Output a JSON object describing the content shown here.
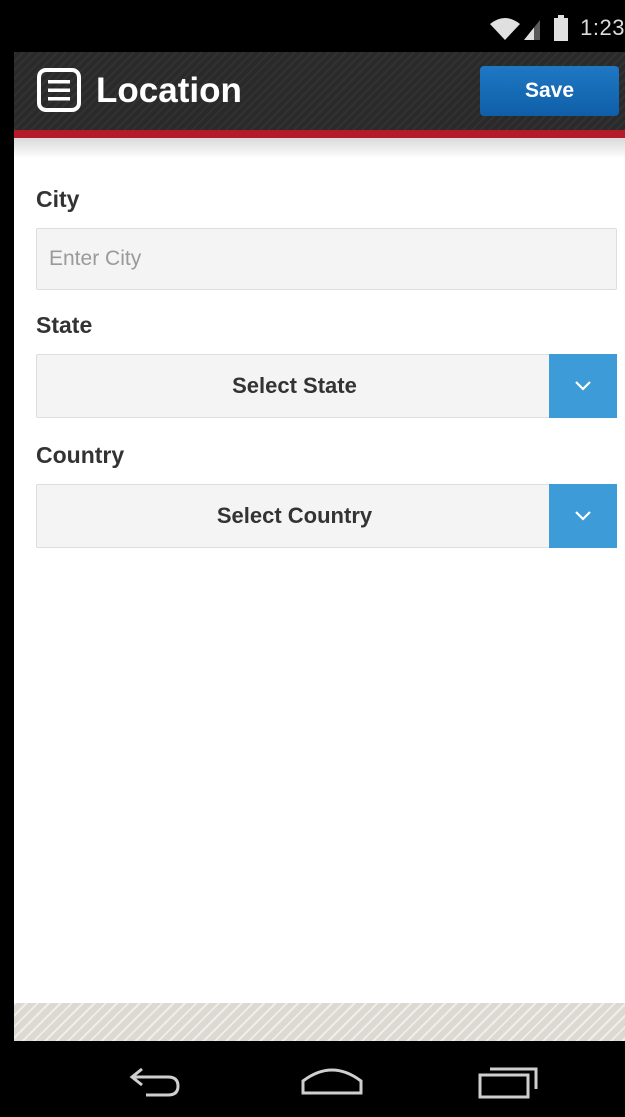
{
  "status_bar": {
    "time": "1:23",
    "icons": [
      "wifi-icon",
      "signal-icon",
      "battery-icon"
    ]
  },
  "header": {
    "title": "Location",
    "menu_icon": "menu-icon",
    "save_label": "Save",
    "bar_color": "#2a2a2a",
    "accent_line_color": "#b31b2b",
    "save_color": "#1570be"
  },
  "form": {
    "city": {
      "label": "City",
      "placeholder": "Enter City",
      "value": ""
    },
    "state": {
      "label": "State",
      "selected": "Select State",
      "arrow_icon": "chevron-down-icon"
    },
    "country": {
      "label": "Country",
      "selected": "Select Country",
      "arrow_icon": "chevron-down-icon"
    },
    "dropdown_accent": "#3d9bd8"
  },
  "nav_bar": {
    "buttons": [
      "back-icon",
      "home-icon",
      "recent-apps-icon"
    ]
  }
}
